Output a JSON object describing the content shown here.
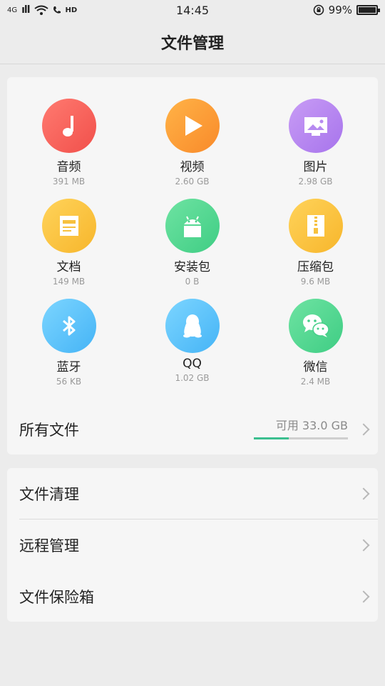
{
  "status_bar": {
    "network": "4G",
    "signal": "ıll",
    "hd": "HD",
    "time": "14:45",
    "battery_percent": "99%",
    "battery_level": 0.99
  },
  "header": {
    "title": "文件管理"
  },
  "categories": [
    {
      "name": "音频",
      "size": "391 MB",
      "icon": "music-note-icon",
      "color_from": "#ff7a70",
      "color_to": "#f1504b"
    },
    {
      "name": "视频",
      "size": "2.60 GB",
      "icon": "play-icon",
      "color_from": "#ffb347",
      "color_to": "#f98a2a"
    },
    {
      "name": "图片",
      "size": "2.98 GB",
      "icon": "image-icon",
      "color_from": "#c89cf5",
      "color_to": "#a774ec"
    },
    {
      "name": "文档",
      "size": "149 MB",
      "icon": "document-icon",
      "color_from": "#ffd35a",
      "color_to": "#f7b62c"
    },
    {
      "name": "安装包",
      "size": "0 B",
      "icon": "android-icon",
      "color_from": "#6ee3a2",
      "color_to": "#3fcd84"
    },
    {
      "name": "压缩包",
      "size": "9.6 MB",
      "icon": "zip-icon",
      "color_from": "#ffd35a",
      "color_to": "#f7b62c"
    },
    {
      "name": "蓝牙",
      "size": "56 KB",
      "icon": "bluetooth-icon",
      "color_from": "#7cd5ff",
      "color_to": "#45b4f6"
    },
    {
      "name": "QQ",
      "size": "1.02 GB",
      "icon": "qq-penguin-icon",
      "color_from": "#7cd5ff",
      "color_to": "#45b4f6"
    },
    {
      "name": "微信",
      "size": "2.4 MB",
      "icon": "wechat-icon",
      "color_from": "#6ee3a2",
      "color_to": "#3fcd84"
    }
  ],
  "all_files": {
    "label": "所有文件",
    "available": "可用 33.0 GB",
    "used_fraction": 0.37,
    "bar_color": "#3bbf8f"
  },
  "tools": [
    {
      "label": "文件清理"
    },
    {
      "label": "远程管理"
    },
    {
      "label": "文件保险箱"
    }
  ]
}
